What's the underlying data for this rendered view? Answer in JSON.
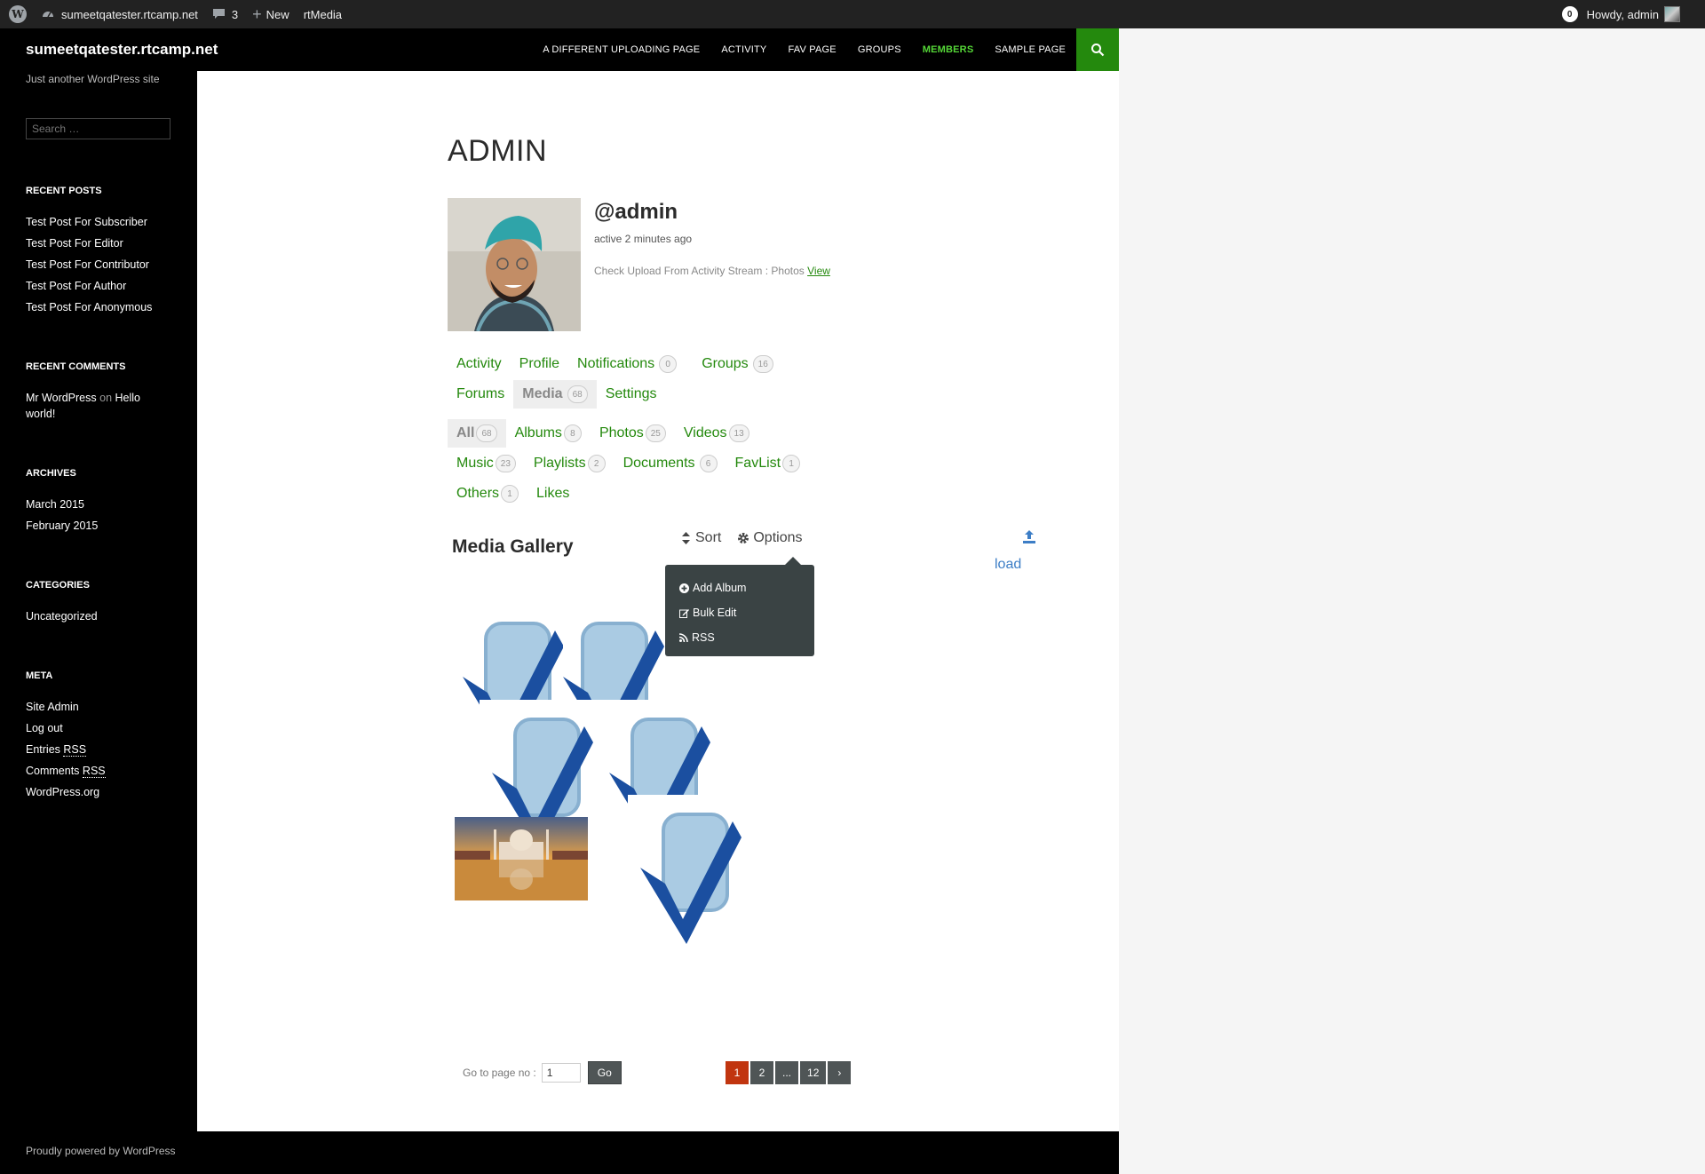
{
  "adminbar": {
    "site_name": "sumeetqatester.rtcamp.net",
    "comments_count": "3",
    "new_label": "New",
    "plugin_label": "rtMedia",
    "notification_count": "0",
    "greeting": "Howdy, admin"
  },
  "header": {
    "site_title": "sumeetqatester.rtcamp.net",
    "nav": [
      "A DIFFERENT UPLOADING PAGE",
      "ACTIVITY",
      "FAV PAGE",
      "GROUPS",
      "MEMBERS",
      "SAMPLE PAGE"
    ],
    "current_nav": "MEMBERS"
  },
  "sidebar": {
    "tagline": "Just another WordPress site",
    "search_placeholder": "Search …",
    "recent_posts_title": "RECENT POSTS",
    "recent_posts": [
      "Test Post For Subscriber",
      "Test Post For Editor",
      "Test Post For Contributor",
      "Test Post For Author",
      "Test Post For Anonymous"
    ],
    "recent_comments_title": "RECENT COMMENTS",
    "comment_author": "Mr WordPress",
    "comment_on": "on",
    "comment_post": "Hello world!",
    "archives_title": "ARCHIVES",
    "archives": [
      "March 2015",
      "February 2015"
    ],
    "categories_title": "CATEGORIES",
    "categories": [
      "Uncategorized"
    ],
    "meta_title": "META",
    "meta_site_admin": "Site Admin",
    "meta_log_out": "Log out",
    "meta_entries": "Entries",
    "meta_comments": "Comments",
    "meta_rss": "RSS",
    "meta_wordpress": "WordPress.org"
  },
  "profile": {
    "page_title": "ADMIN",
    "username": "@admin",
    "last_active": "active 2 minutes ago",
    "latest_update": "Check Upload From Activity Stream : Photos",
    "latest_update_link": "View"
  },
  "profile_nav": {
    "items": [
      {
        "label": "Activity"
      },
      {
        "label": "Profile"
      },
      {
        "label": "Notifications",
        "count": "0"
      },
      {
        "label": "Groups",
        "count": "16"
      },
      {
        "label": "Forums"
      },
      {
        "label": "Media",
        "count": "68",
        "selected": true
      },
      {
        "label": "Settings"
      }
    ]
  },
  "media_nav": {
    "items": [
      {
        "label": "All",
        "count": "68",
        "selected": true
      },
      {
        "label": "Albums",
        "count": "8"
      },
      {
        "label": "Photos",
        "count": "25"
      },
      {
        "label": "Videos",
        "count": "13"
      },
      {
        "label": "Music",
        "count": "23"
      },
      {
        "label": "Playlists",
        "count": "2"
      },
      {
        "label": "Documents",
        "count": "6"
      },
      {
        "label": "FavList",
        "count": "1"
      },
      {
        "label": "Others",
        "count": "1"
      },
      {
        "label": "Likes"
      }
    ]
  },
  "gallery": {
    "heading": "Media Gallery",
    "sort_label": "Sort",
    "options_label": "Options",
    "upload_label": "Upload",
    "upload_visible": "load",
    "options_menu": [
      "Add Album",
      "Bulk Edit",
      "RSS"
    ],
    "icons": {
      "sort": "sort-icon",
      "options": "gear-icon",
      "upload": "upload-icon"
    }
  },
  "pagination": {
    "goto_label": "Go to page no :",
    "goto_value": "1",
    "go_button": "Go",
    "pages": [
      "1",
      "2",
      "...",
      "12",
      "›"
    ],
    "current_page": "1"
  },
  "footer": {
    "text": "Proudly powered by WordPress"
  },
  "colors": {
    "accent_green": "#24890d",
    "current_nav_green": "#55d737",
    "current_page": "#c1350f",
    "menu_bg": "#3a4344"
  }
}
